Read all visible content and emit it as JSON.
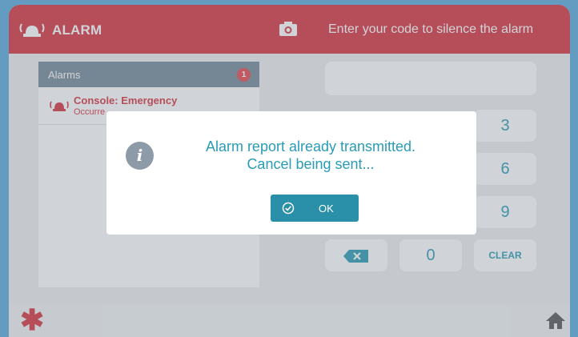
{
  "header": {
    "title": "ALARM",
    "prompt": "Enter your code to silence the alarm"
  },
  "alarms": {
    "label": "Alarms",
    "count": "1",
    "items": [
      {
        "name": "Console: Emergency",
        "subtitle": "Occurre"
      }
    ]
  },
  "keypad": {
    "keys": {
      "k3": "3",
      "k6": "6",
      "k9": "9",
      "k0": "0",
      "clear": "CLEAR"
    }
  },
  "dialog": {
    "line1": "Alarm report already transmitted.",
    "line2": "Cancel being sent...",
    "ok_label": "OK"
  },
  "colors": {
    "header_red": "#d8333f",
    "accent_teal": "#2a9bb5",
    "frame_blue": "#5aa9dc"
  },
  "icons": [
    "siren-icon",
    "camera-icon",
    "info-icon",
    "check-circle-icon",
    "backspace-icon",
    "asterisk-icon",
    "home-icon"
  ]
}
